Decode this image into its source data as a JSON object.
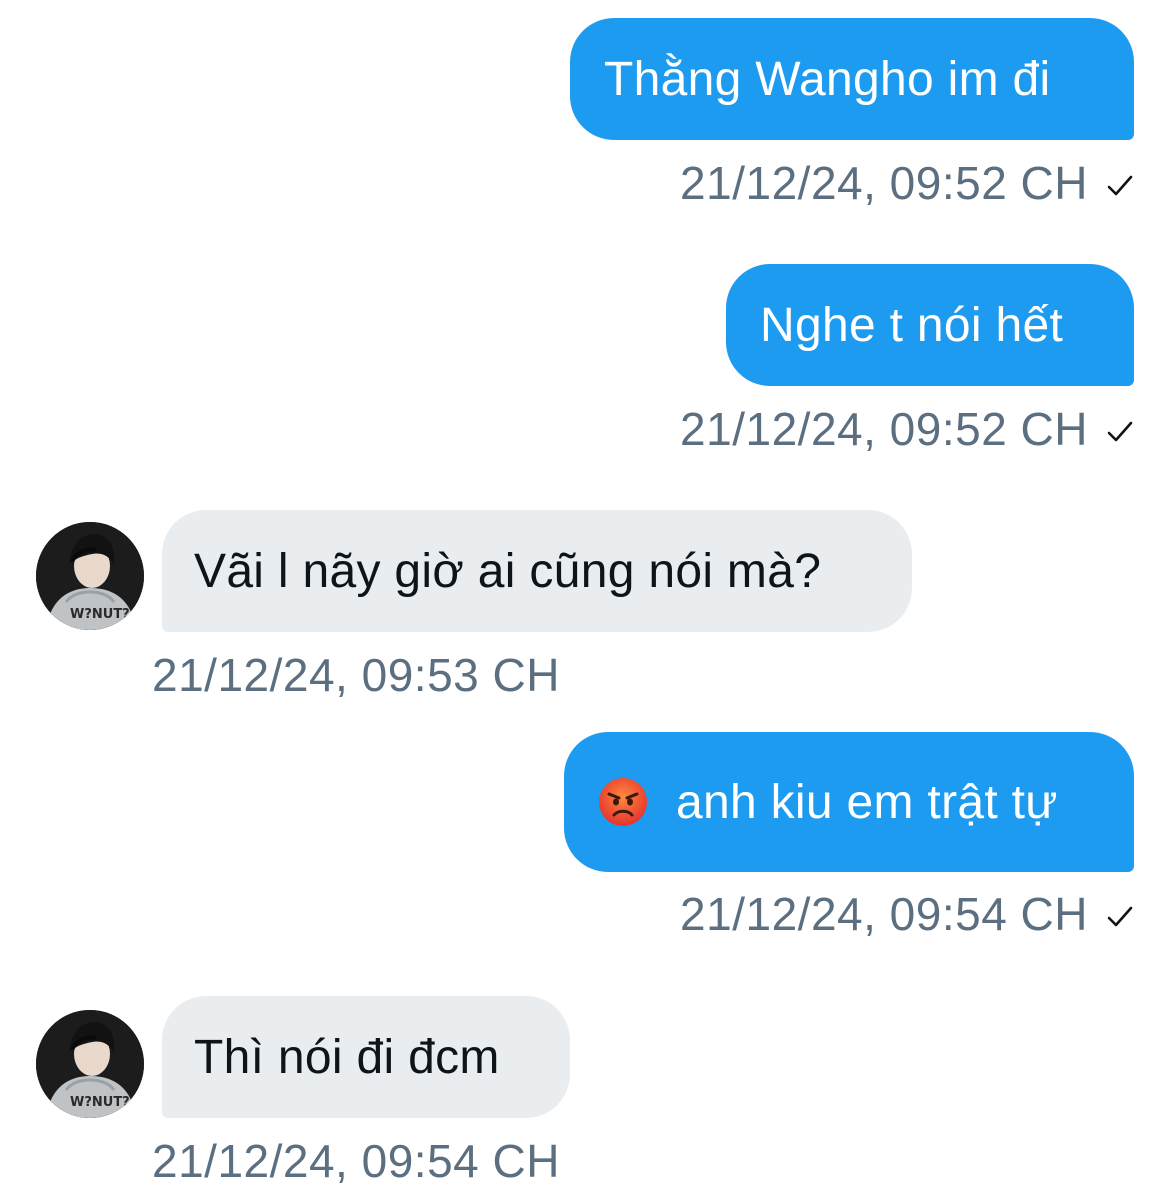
{
  "messages": [
    {
      "direction": "out",
      "text": "Thằng Wangho im đi",
      "time": "21/12/24, 09:52 CH",
      "status_icon": "check-icon"
    },
    {
      "direction": "out",
      "text": "Nghe t nói hết",
      "time": "21/12/24, 09:52 CH",
      "status_icon": "check-icon"
    },
    {
      "direction": "in",
      "text": "Vãi l nãy giờ ai cũng nói mà?",
      "time": "21/12/24, 09:53 CH",
      "avatar_icon": "contact-avatar"
    },
    {
      "direction": "out",
      "emoji": "angry-face-emoji",
      "text": "anh kiu em trật tự",
      "time": "21/12/24, 09:54 CH",
      "status_icon": "check-icon"
    },
    {
      "direction": "in",
      "text": "Thì nói đi đcm",
      "time": "21/12/24, 09:54 CH",
      "avatar_icon": "contact-avatar"
    }
  ],
  "colors": {
    "outgoing_bubble": "#1d9bf0",
    "incoming_bubble": "#e9edf0",
    "timestamp": "#5b6f80"
  }
}
